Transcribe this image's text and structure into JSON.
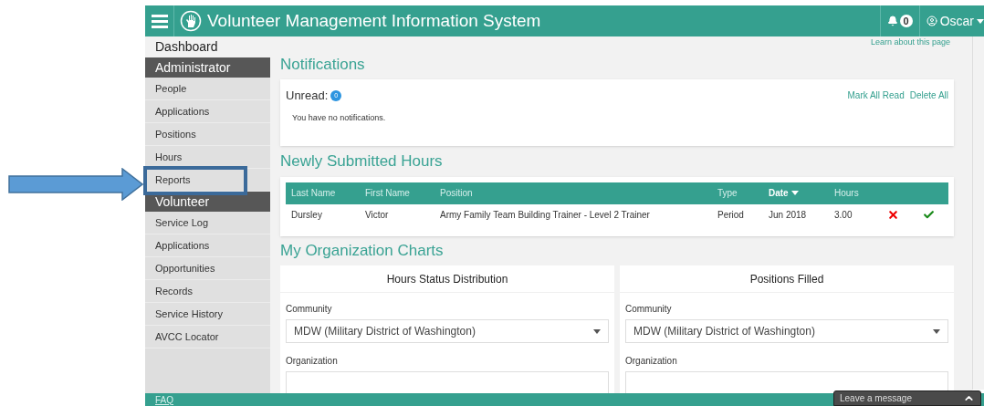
{
  "header": {
    "title": "Volunteer Management Information System",
    "notification_count": "0",
    "user": "Oscar"
  },
  "sidebar": {
    "dashboard": "Dashboard",
    "sections": [
      {
        "title": "Administrator",
        "items": [
          {
            "label": "People"
          },
          {
            "label": "Applications"
          },
          {
            "label": "Positions"
          },
          {
            "label": "Hours"
          },
          {
            "label": "Reports"
          }
        ]
      },
      {
        "title": "Volunteer",
        "items": [
          {
            "label": "Service Log"
          },
          {
            "label": "Applications"
          },
          {
            "label": "Opportunities"
          },
          {
            "label": "Records"
          },
          {
            "label": "Service History"
          },
          {
            "label": "AVCC Locator"
          }
        ]
      }
    ]
  },
  "help_link": "Learn about this page",
  "notifications": {
    "title": "Notifications",
    "unread_label": "Unread:",
    "unread_count": "0",
    "actions": [
      "Mark All Read",
      "Delete All"
    ],
    "message": "You have no notifications."
  },
  "hours": {
    "title": "Newly Submitted Hours",
    "columns": [
      {
        "label": "Last Name",
        "sorted": false
      },
      {
        "label": "First Name",
        "sorted": false
      },
      {
        "label": "Position",
        "sorted": false
      },
      {
        "label": "Type",
        "sorted": false
      },
      {
        "label": "Date",
        "sorted": true
      },
      {
        "label": "Hours",
        "sorted": false
      }
    ],
    "rows": [
      {
        "cells": [
          "Dursley",
          "Victor",
          "Army Family Team Building Trainer - Level 2 Trainer",
          "Period",
          "Jun 2018",
          "3.00"
        ]
      }
    ]
  },
  "charts": {
    "title": "My Organization Charts",
    "panels": [
      {
        "title": "Hours Status Distribution",
        "fields": [
          {
            "label": "Community",
            "value": "MDW (Military District of Washington)"
          },
          {
            "label": "Organization"
          }
        ]
      },
      {
        "title": "Positions Filled",
        "fields": [
          {
            "label": "Community",
            "value": "MDW (Military District of Washington)"
          },
          {
            "label": "Organization"
          }
        ]
      }
    ]
  },
  "footer": {
    "link": "FAQ"
  },
  "chat": {
    "label": "Leave a message"
  }
}
